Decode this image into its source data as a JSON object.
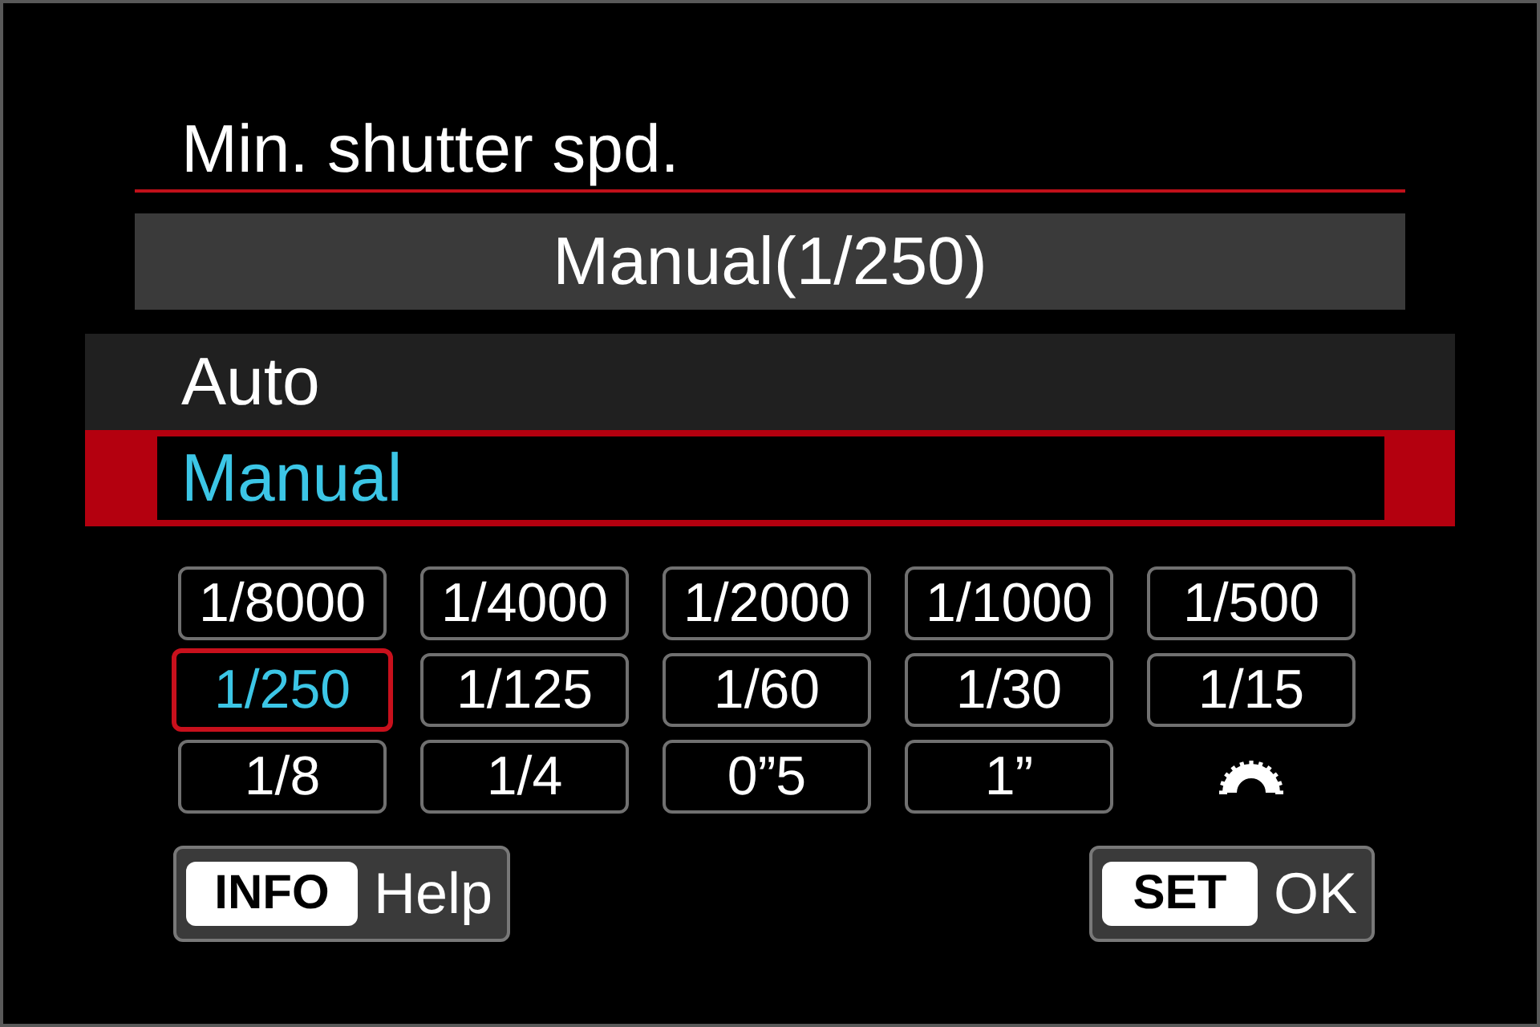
{
  "title": "Min. shutter spd.",
  "current_setting": "Manual(1/250)",
  "options": [
    {
      "label": "Auto",
      "selected": false
    },
    {
      "label": "Manual",
      "selected": true
    }
  ],
  "shutter_speeds": [
    {
      "kind": "value",
      "label": "1/8000",
      "selected": false
    },
    {
      "kind": "value",
      "label": "1/4000",
      "selected": false
    },
    {
      "kind": "value",
      "label": "1/2000",
      "selected": false
    },
    {
      "kind": "value",
      "label": "1/1000",
      "selected": false
    },
    {
      "kind": "value",
      "label": "1/500",
      "selected": false
    },
    {
      "kind": "value",
      "label": "1/250",
      "selected": true
    },
    {
      "kind": "value",
      "label": "1/125",
      "selected": false
    },
    {
      "kind": "value",
      "label": "1/60",
      "selected": false
    },
    {
      "kind": "value",
      "label": "1/30",
      "selected": false
    },
    {
      "kind": "value",
      "label": "1/15",
      "selected": false
    },
    {
      "kind": "value",
      "label": "1/8",
      "selected": false
    },
    {
      "kind": "value",
      "label": "1/4",
      "selected": false
    },
    {
      "kind": "value",
      "label": "0”5",
      "selected": false
    },
    {
      "kind": "value",
      "label": "1”",
      "selected": false
    },
    {
      "kind": "dial",
      "selected": false
    }
  ],
  "footer_buttons": [
    {
      "key": "INFO",
      "label": "Help"
    },
    {
      "key": "SET",
      "label": "OK"
    }
  ]
}
